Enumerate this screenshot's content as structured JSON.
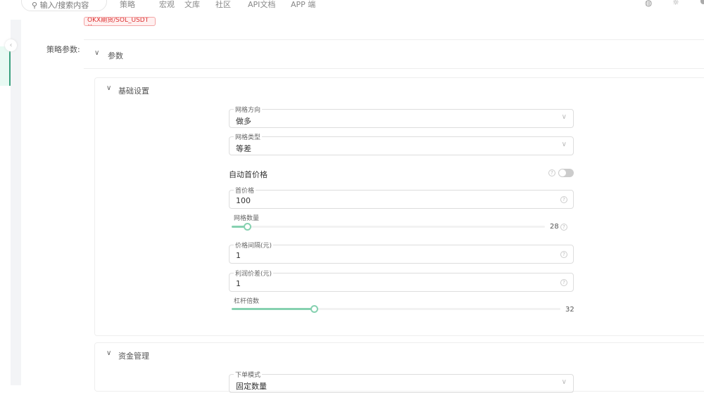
{
  "header": {
    "search_placeholder": "输入/搜索内容",
    "nav": [
      "策略",
      "宏观",
      "文库",
      "社区",
      "API文档",
      "APP 端"
    ]
  },
  "tag": "OKX期货/SOL_USDT ×",
  "form_label": "策略参数:",
  "params_section": "参数",
  "basic": {
    "title": "基础设置",
    "grid_direction": {
      "label": "网格方向",
      "value": "做多"
    },
    "grid_type": {
      "label": "网格类型",
      "value": "等差"
    },
    "auto_first_price": {
      "label": "自动首价格",
      "enabled": false
    },
    "first_price": {
      "label": "首价格",
      "value": "100"
    },
    "grid_count": {
      "label": "网格数量",
      "value": "28",
      "fraction": 0.05
    },
    "price_interval": {
      "label": "价格间隔(元)",
      "value": "1"
    },
    "profit_spread": {
      "label": "利润价差(元)",
      "value": "1"
    },
    "leverage": {
      "label": "杠杆倍数",
      "value": "32",
      "fraction": 0.25
    }
  },
  "funds": {
    "title": "资金管理",
    "order_mode": {
      "label": "下单模式",
      "value": "固定数量"
    }
  }
}
